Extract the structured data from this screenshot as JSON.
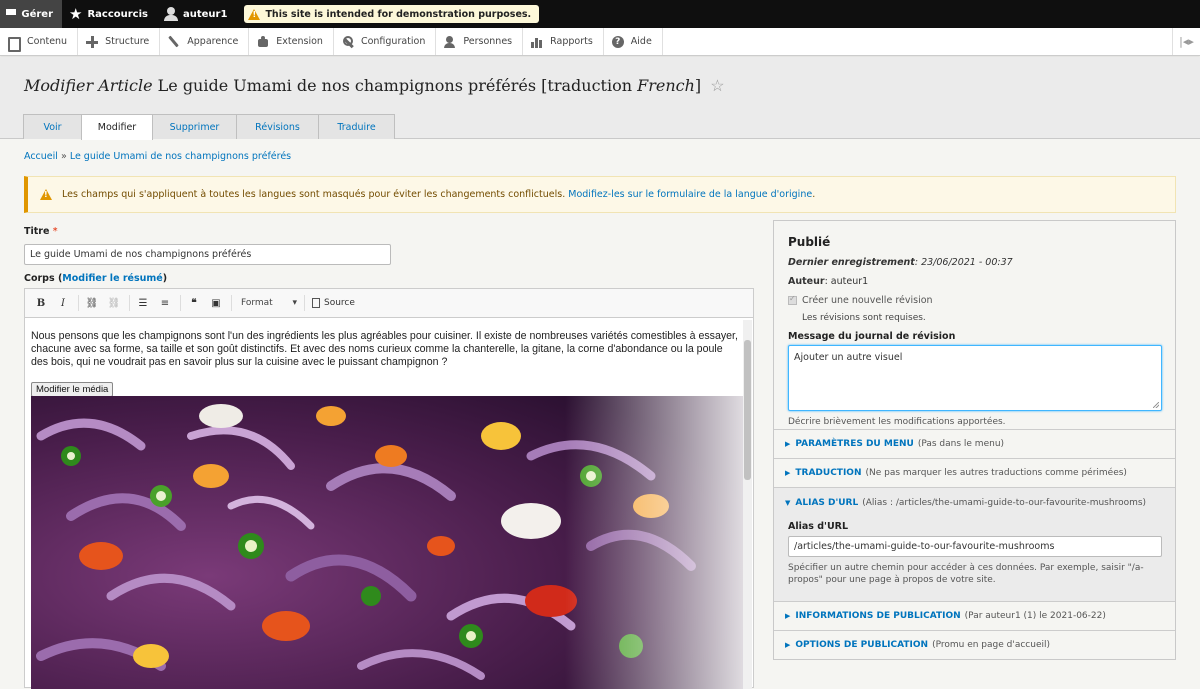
{
  "toolbar": {
    "manage_label": "Gérer",
    "shortcuts_label": "Raccourcis",
    "user_label": "auteur1",
    "demo_notice": "This site is intended for demonstration purposes."
  },
  "tray": {
    "items": [
      {
        "label": "Contenu",
        "icon": "content-icon"
      },
      {
        "label": "Structure",
        "icon": "structure-icon"
      },
      {
        "label": "Apparence",
        "icon": "brush-icon"
      },
      {
        "label": "Extension",
        "icon": "puzzle-icon"
      },
      {
        "label": "Configuration",
        "icon": "wrench-icon"
      },
      {
        "label": "Personnes",
        "icon": "people-icon"
      },
      {
        "label": "Rapports",
        "icon": "reports-icon"
      },
      {
        "label": "Aide",
        "icon": "help-icon"
      }
    ],
    "toggle_icon": "collapse-tray-icon"
  },
  "header": {
    "title_prefix": "Modifier Article",
    "title_main": " Le guide Umami de nos champignons préférés [traduction ",
    "title_lang": "French",
    "title_suffix": "]",
    "tabs": [
      {
        "label": "Voir"
      },
      {
        "label": "Modifier",
        "active": true
      },
      {
        "label": "Supprimer"
      },
      {
        "label": "Révisions"
      },
      {
        "label": "Traduire"
      }
    ]
  },
  "breadcrumb": {
    "home": "Accueil",
    "separator": "»",
    "current": "Le guide Umami de nos champignons préférés"
  },
  "warning": {
    "text": "Les champs qui s'appliquent à toutes les langues sont masqués pour éviter les changements conflictuels.",
    "link": "Modifiez-les sur le formulaire de la langue d'origine",
    "end": "."
  },
  "form": {
    "title_label": "Titre",
    "title_required": "*",
    "title_value": "Le guide Umami de nos champignons préférés",
    "body_label": "Corps",
    "body_summary_open": "(",
    "body_summary_link": "Modifier le résumé",
    "body_summary_close": ")",
    "editor": {
      "format_label": "Format",
      "source_label": "Source",
      "text": "Nous pensons que les champignons sont l'un des ingrédients les plus agréables pour cuisiner. Il existe de nombreuses variétés comestibles à essayer, chacune avec sa forme, sa taille et son goût distinctifs. Et avec des noms curieux comme la chanterelle, la gitane, la corne d'abondance ou la poule des bois, qui ne voudrait pas en savoir plus sur la cuisine avec le puissant champignon ?",
      "media_button": "Modifier le média"
    }
  },
  "sidebar": {
    "status": "Publié",
    "last_saved_label": "Dernier enregistrement",
    "last_saved_value": "23/06/2021 - 00:37",
    "author_label": "Auteur",
    "author_value": "auteur1",
    "new_revision_label": "Créer une nouvelle révision",
    "revisions_required": "Les révisions sont requises.",
    "log_label": "Message du journal de révision",
    "log_value": "Ajouter un autre visuel",
    "log_desc": "Décrire brièvement les modifications apportées.",
    "sections": [
      {
        "title": "Paramètres du menu",
        "summary": "(Pas dans le menu)"
      },
      {
        "title": "Traduction",
        "summary": "(Ne pas marquer les autres traductions comme périmées)"
      }
    ],
    "alias": {
      "title": "Alias d'URL",
      "summary": "(Alias : /articles/the-umami-guide-to-our-favourite-mushrooms)",
      "field_label": "Alias d'URL",
      "field_value": "/articles/the-umami-guide-to-our-favourite-mushrooms",
      "desc": "Spécifier un autre chemin pour accéder à ces données. Par exemple, saisir \"/a-propos\" pour une page à propos de votre site."
    },
    "sections_after": [
      {
        "title": "Informations de publication",
        "summary": "(Par auteur1 (1) le 2021-06-22)"
      },
      {
        "title": "Options de publication",
        "summary": "(Promu en page d'accueil)"
      }
    ]
  },
  "colors": {
    "link": "#0074bd",
    "warning_accent": "#e09600",
    "focus": "#40b6ff"
  }
}
